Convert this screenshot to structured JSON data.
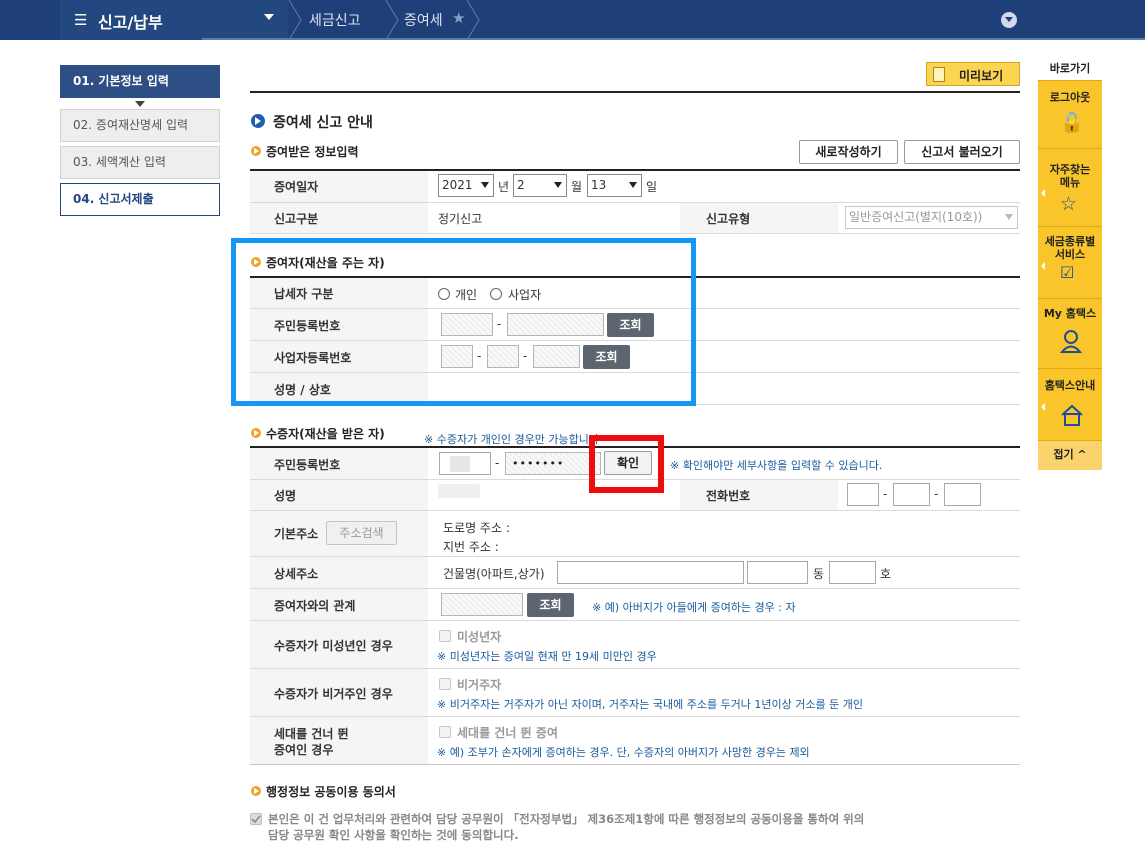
{
  "topbar": {
    "menu_title": "신고/납부",
    "breadcrumb": [
      "세금신고",
      "증여세"
    ]
  },
  "steps": [
    {
      "label": "01. 기본정보 입력"
    },
    {
      "label": "02. 증여재산명세 입력"
    },
    {
      "label": "03. 세액계산 입력"
    },
    {
      "label": "04. 신고서제출"
    }
  ],
  "preview_button": "미리보기",
  "page_title": "증여세 신고 안내",
  "section_received": {
    "title": "증여받은 정보입력",
    "new_button": "새로작성하기",
    "load_button": "신고서 불러오기",
    "gift_date_label": "증여일자",
    "year": "2021",
    "year_unit": "년",
    "month": "2",
    "month_unit": "월",
    "day": "13",
    "day_unit": "일",
    "report_kind_label": "신고구분",
    "report_kind_value": "정기신고",
    "report_type_label": "신고유형",
    "report_type_value": "일반증여신고(별지(10호))"
  },
  "section_donor": {
    "title": "증여자(재산을 주는 자)",
    "taxpayer_type_label": "납세자 구분",
    "option_individual": "개인",
    "option_business": "사업자",
    "rrn_label": "주민등록번호",
    "brn_label": "사업자등록번호",
    "name_label": "성명 / 상호",
    "query_button": "조회",
    "dash": "-"
  },
  "section_donee": {
    "title": "수증자(재산을 받은 자)",
    "title_note": "※ 수증자가 개인인 경우만 가능합니다",
    "rrn_label": "주민등록번호",
    "rrn_masked": "•••••••",
    "confirm_button": "확인",
    "confirm_note": "※ 확인해야만 세부사항을 입력할 수 있습니다.",
    "name_label": "성명",
    "phone_label": "전화번호",
    "addr_label": "기본주소",
    "addr_search_button": "주소검색",
    "road_addr_label": "도로명 주소 :",
    "lot_addr_label": "지번 주소 :",
    "detail_addr_label": "상세주소",
    "building_label": "건물명(아파트,상가)",
    "dong_unit": "동",
    "ho_unit": "호",
    "relation_label": "증여자와의 관계",
    "relation_note": "※ 예) 아버지가 아들에게 증여하는 경우 : 자",
    "minor_label": "수증자가 미성년인 경우",
    "minor_check": "미성년자",
    "minor_note": "※ 미성년자는 증여일 현재 만 19세 미만인 경우",
    "nonres_label": "수증자가 비거주인 경우",
    "nonres_check": "비거주자",
    "nonres_note": "※ 비거주자는 거주자가 아닌 자이며, 거주자는 국내에 주소를 두거나 1년이상 거소를 둔 개인",
    "skip_label_1": "세대를 건너 뛴",
    "skip_label_2": "증여인 경우",
    "skip_check": "세대를 건너 뛴 증여",
    "skip_note": "※ 예) 조부가 손자에게 증여하는 경우. 단, 수증자의 아버지가 사망한 경우는 제외"
  },
  "section_consent": {
    "title": "행정정보 공동이용 동의서",
    "text_line1": "본인은 이 건 업무처리와 관련하여 담당 공무원이 「전자정부법」 제36조제1항에 따른 행정정보의 공동이용을 통하여 위의",
    "text_line2": "담당 공무원 확인 사항을 확인하는 것에 동의합니다."
  },
  "quickbar": {
    "title": "바로가기",
    "logout": "로그아웃",
    "faq_menu_1": "자주찾는",
    "faq_menu_2": "메뉴",
    "tax_service_1": "세금종류별",
    "tax_service_2": "서비스",
    "my_hometax": "My 홈택스",
    "hometax_guide": "홈택스안내",
    "fold": "접기 ^"
  },
  "colors": {
    "nav_blue": "#1e3f77",
    "highlight_blue": "#1797f5",
    "highlight_red": "#ee0d0d",
    "quickbar_yellow": "#fac52a"
  }
}
